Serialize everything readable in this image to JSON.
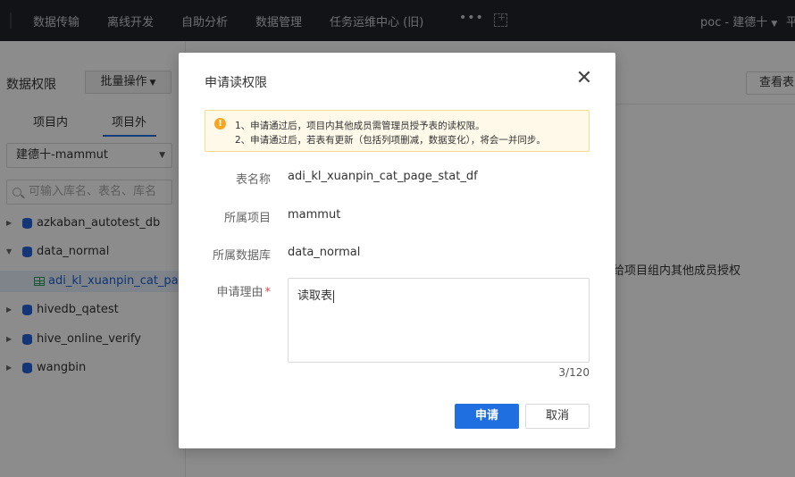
{
  "topnav": {
    "items": [
      "数据传输",
      "离线开发",
      "自助分析",
      "数据管理",
      "任务运维中心 (旧)"
    ],
    "more": "•••",
    "project": "poc - 建德十",
    "extra": "平"
  },
  "sidebar": {
    "title": "数据权限",
    "batch_button": "批量操作",
    "tabs": [
      "项目内",
      "项目外"
    ],
    "active_tab": "项目外",
    "project_select": "建德十-mammut",
    "search_placeholder": "可输入库名、表名、库名",
    "tree": [
      {
        "label": "azkaban_autotest_db",
        "expanded": false
      },
      {
        "label": "data_normal",
        "expanded": true
      },
      {
        "label": "adi_kl_xuanpin_cat_pag...",
        "type": "table",
        "selected": true
      },
      {
        "label": "hivedb_qatest",
        "expanded": false
      },
      {
        "label": "hive_online_verify",
        "expanded": false
      },
      {
        "label": "wangbin",
        "expanded": false
      }
    ]
  },
  "main": {
    "view_button": "查看表",
    "body_text": "给项目组内其他成员授权"
  },
  "modal": {
    "title": "申请读权限",
    "notice_lines": [
      "1、申请通过后，项目内其他成员需管理员授予表的读权限。",
      "2、申请通过后，若表有更新（包括列项删减，数据变化），将会一并同步。"
    ],
    "fields": {
      "table_name_label": "表名称",
      "table_name_value": "adi_kl_xuanpin_cat_page_stat_df",
      "project_label": "所属项目",
      "project_value": "mammut",
      "database_label": "所属数据库",
      "database_value": "data_normal",
      "reason_label": "申请理由",
      "reason_required": "*",
      "reason_value": "读取表",
      "counter": "3/120"
    },
    "submit_button": "申请",
    "cancel_button": "取消"
  }
}
